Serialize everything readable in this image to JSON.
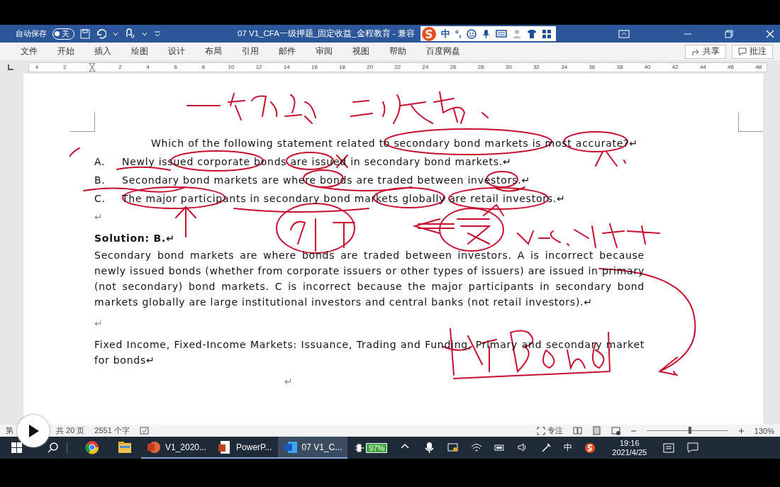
{
  "title_bar": {
    "autosave_label": "自动保存",
    "autosave_toggle": {
      "label": "关",
      "on": false
    },
    "document_title": "07 V1_CFA一级押题_固定收益_金程教育 - 兼容",
    "ime_mode": "中",
    "ime_punctuation": "°,"
  },
  "menu": {
    "tabs": [
      "文件",
      "开始",
      "插入",
      "绘图",
      "设计",
      "布局",
      "引用",
      "邮件",
      "审阅",
      "视图",
      "帮助",
      "百度网盘"
    ],
    "share": "共享",
    "comments": "批注"
  },
  "ruler": {
    "left_labels": [
      "4",
      "2"
    ],
    "labels": [
      "2",
      "4",
      "6",
      "8",
      "10",
      "12",
      "14",
      "16",
      "18",
      "20",
      "22",
      "24",
      "26",
      "28",
      "30",
      "32",
      "34",
      "36",
      "38",
      "40",
      "42",
      "44",
      "46",
      "48"
    ]
  },
  "document": {
    "question": "Which of the following statement related to secondary bond markets is most accurate?↵",
    "options": [
      {
        "letter": "A.",
        "text": "Newly issued corporate bonds are issued in secondary bond markets.↵"
      },
      {
        "letter": "B.",
        "text": "Secondary bond markets are where bonds are traded between investors.↵"
      },
      {
        "letter": "C.",
        "text": "The major participants in secondary bond markets globally are retail investors.↵"
      }
    ],
    "blank_mark": "↵",
    "solution_heading": "Solution: B.↵",
    "solution_text": "Secondary bond markets are where bonds are traded between investors. A is incorrect because newly issued bonds (whether from corporate issuers or other types of issuers) are issued in primary (not secondary) bond markets. C is incorrect because the major participants in secondary bond markets globally are large institutional investors and central banks (not retail investors).↵",
    "blank_mark_2": "↵",
    "topic_text": "Fixed Income, Fixed-Income Markets: Issuance, Trading and Funding, Primary and secondary market for bonds↵",
    "trailing_mark": "↵"
  },
  "status_bar": {
    "page": "第",
    "pages": "共 20 页",
    "words": "2551 个字",
    "focus": "专注",
    "zoom_slider": {
      "level": 0.55
    },
    "zoom": "130%"
  },
  "taskbar": {
    "apps": [
      {
        "kind": "browser"
      },
      {
        "kind": "folder"
      },
      {
        "kind": "powerpoint",
        "label": "V1_2020...",
        "selected": false
      },
      {
        "kind": "powerpoint-doc",
        "label": "PowerP...",
        "selected": false
      },
      {
        "kind": "word",
        "label": "07 V1_C...",
        "selected": true
      }
    ],
    "battery": "97%",
    "ime": "中",
    "time": "19:16",
    "date": "2021/4/25"
  }
}
